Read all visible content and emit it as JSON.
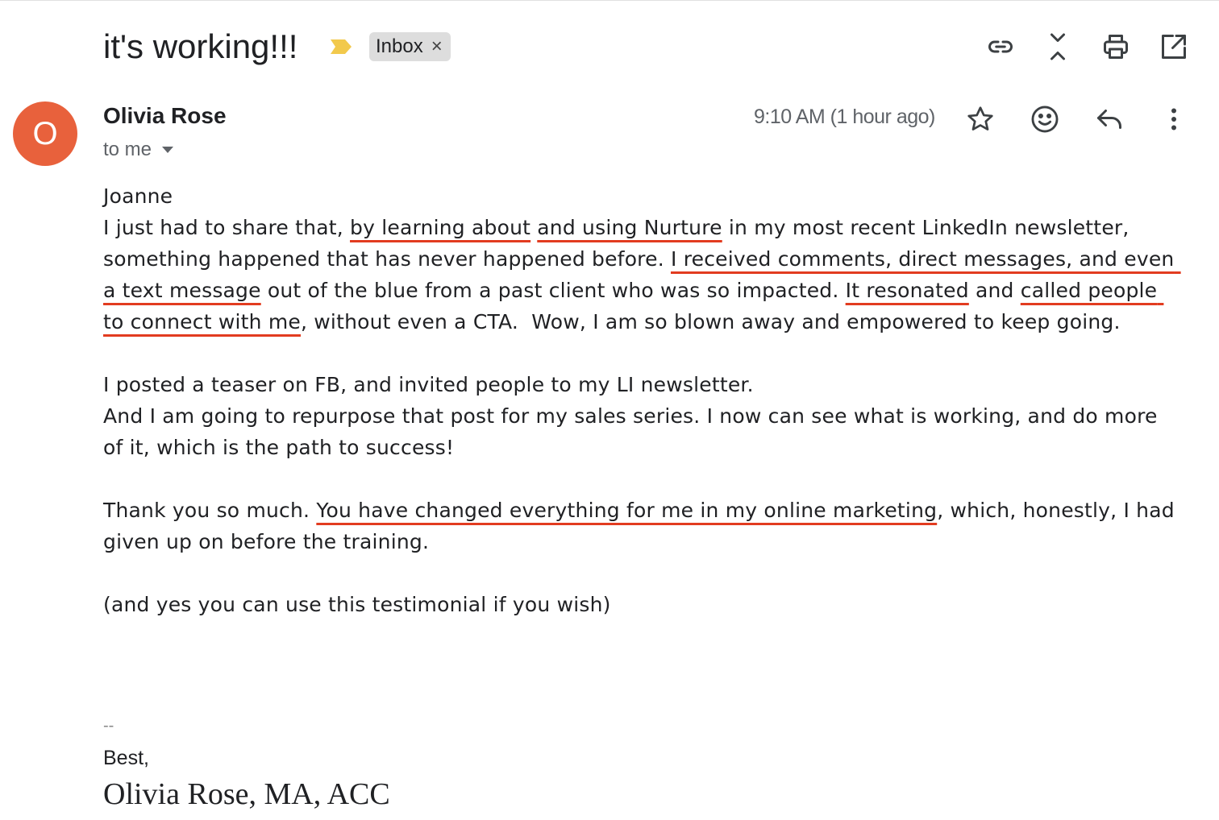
{
  "email": {
    "subject": "it's working!!!",
    "label": "Inbox",
    "label_remove": "×",
    "sender_initial": "O",
    "sender_name": "Olivia Rose",
    "recipient": "to me",
    "timestamp": "9:10 AM (1 hour ago)"
  },
  "toolbar": {
    "icons": [
      "link-icon",
      "collapse-icon",
      "print-icon",
      "open-in-new-window-icon"
    ]
  },
  "header_actions": {
    "icons": [
      "star-icon",
      "emoji-reaction-icon",
      "reply-icon",
      "more-options-icon"
    ]
  },
  "body": {
    "greeting": "Joanne",
    "p1": {
      "s1": "I just had to share that, ",
      "h1": "by learning about",
      "s2": " ",
      "h2": "and using Nurture",
      "s3": " in my most recent LinkedIn newsletter, something happened that has never happened before. ",
      "h3": "I received comments, direct messages, and even a text message",
      "s4": " out of the blue from a past client who was so impacted. ",
      "h4": "It resonated",
      "s5": " and ",
      "h5": "called people to connect with me",
      "s6": ", without even a CTA.  Wow, I am so blown away and empowered to keep going."
    },
    "p2_line1": "I posted a teaser on FB, and invited people to my LI newsletter.",
    "p2_line2": "And I am going to repurpose that post for my sales series. I now can see what is working, and do more of it, which is the path to success!",
    "p3": {
      "s1": "Thank you so much. ",
      "h1": "You have changed everything for me in my online marketing",
      "s2": ", which, honestly, I had given up on before the training."
    },
    "p4": "(and yes you can use this testimonial if you wish)"
  },
  "signature": {
    "dash": "--",
    "closing": "Best,",
    "name": "Olivia Rose, MA, ACC"
  },
  "colors": {
    "avatar": "#e8613c",
    "underline": "#e23c20",
    "importance": "#f2c94c",
    "label_chip": "#dddddd"
  }
}
